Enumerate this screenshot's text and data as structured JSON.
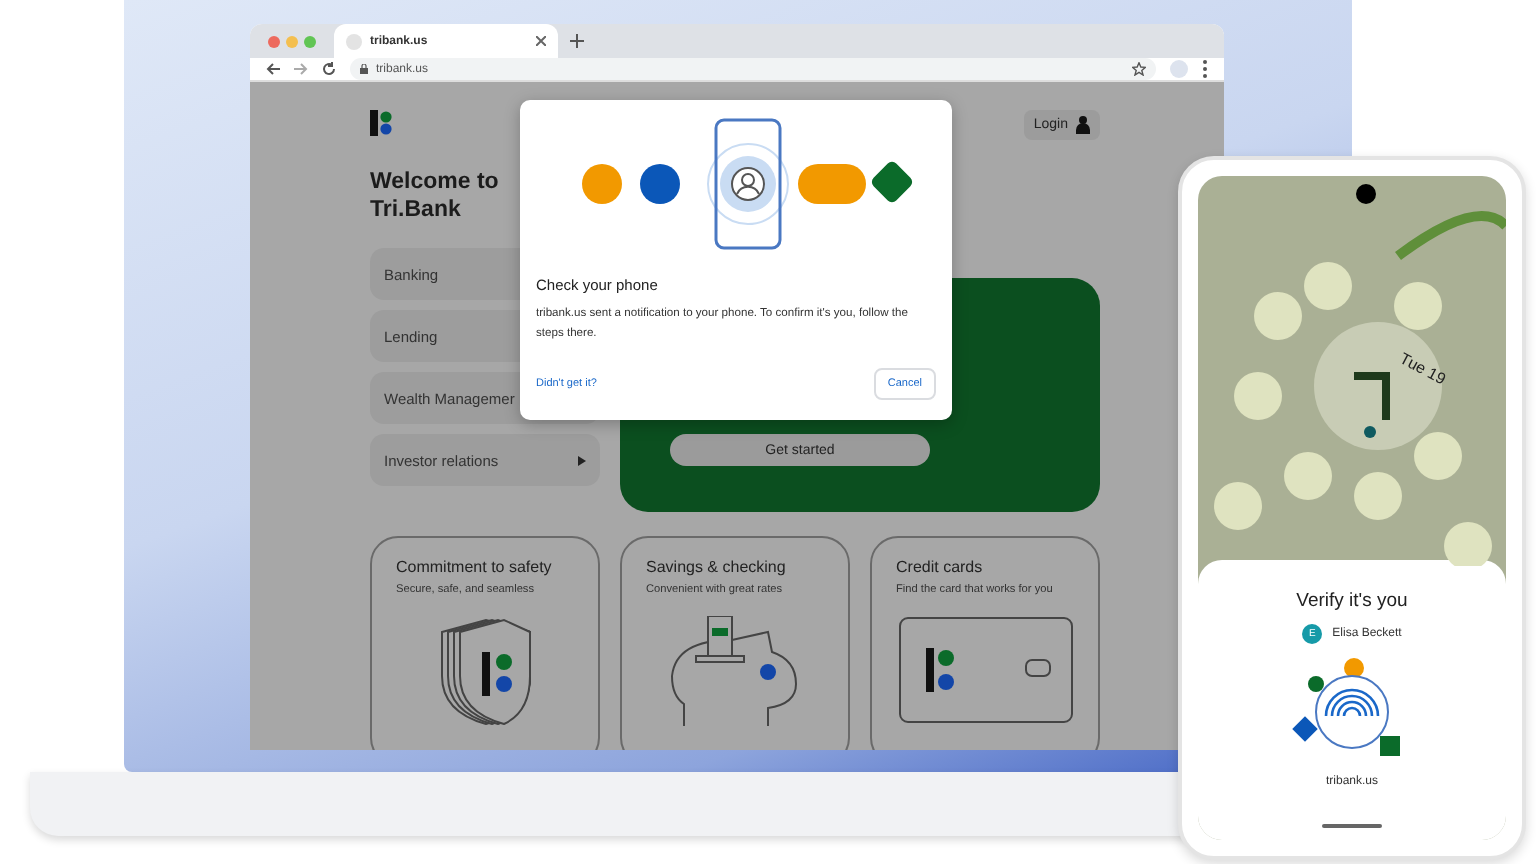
{
  "browser": {
    "tab_title": "tribank.us",
    "url": "tribank.us"
  },
  "site": {
    "login": "Login",
    "heading": "Welcome to Tri.Bank",
    "nav": [
      {
        "label": "Banking",
        "kind": "plain"
      },
      {
        "label": "Lending",
        "kind": "plain"
      },
      {
        "label": "Wealth Managemer",
        "kind": "plain"
      },
      {
        "label": "Investor relations",
        "kind": "submenu"
      }
    ],
    "hero_button": "Get started",
    "cards": [
      {
        "title": "Commitment to safety",
        "subtitle": "Secure, safe, and seamless",
        "kind": "shield"
      },
      {
        "title": "Savings & checking",
        "subtitle": "Convenient with great rates",
        "kind": "piggy"
      },
      {
        "title": "Credit cards",
        "subtitle": "Find the card that works for you",
        "kind": "card"
      }
    ]
  },
  "dialog": {
    "title": "Check your phone",
    "body": "tribank.us sent a notification to your phone. To confirm it's you, follow the steps there.",
    "link": "Didn't get it?",
    "button": "Cancel"
  },
  "phone": {
    "date": "Tue 19",
    "sheet_title": "Verify it's you",
    "account_initial": "E",
    "account_name": "Elisa Beckett",
    "domain": "tribank.us"
  }
}
